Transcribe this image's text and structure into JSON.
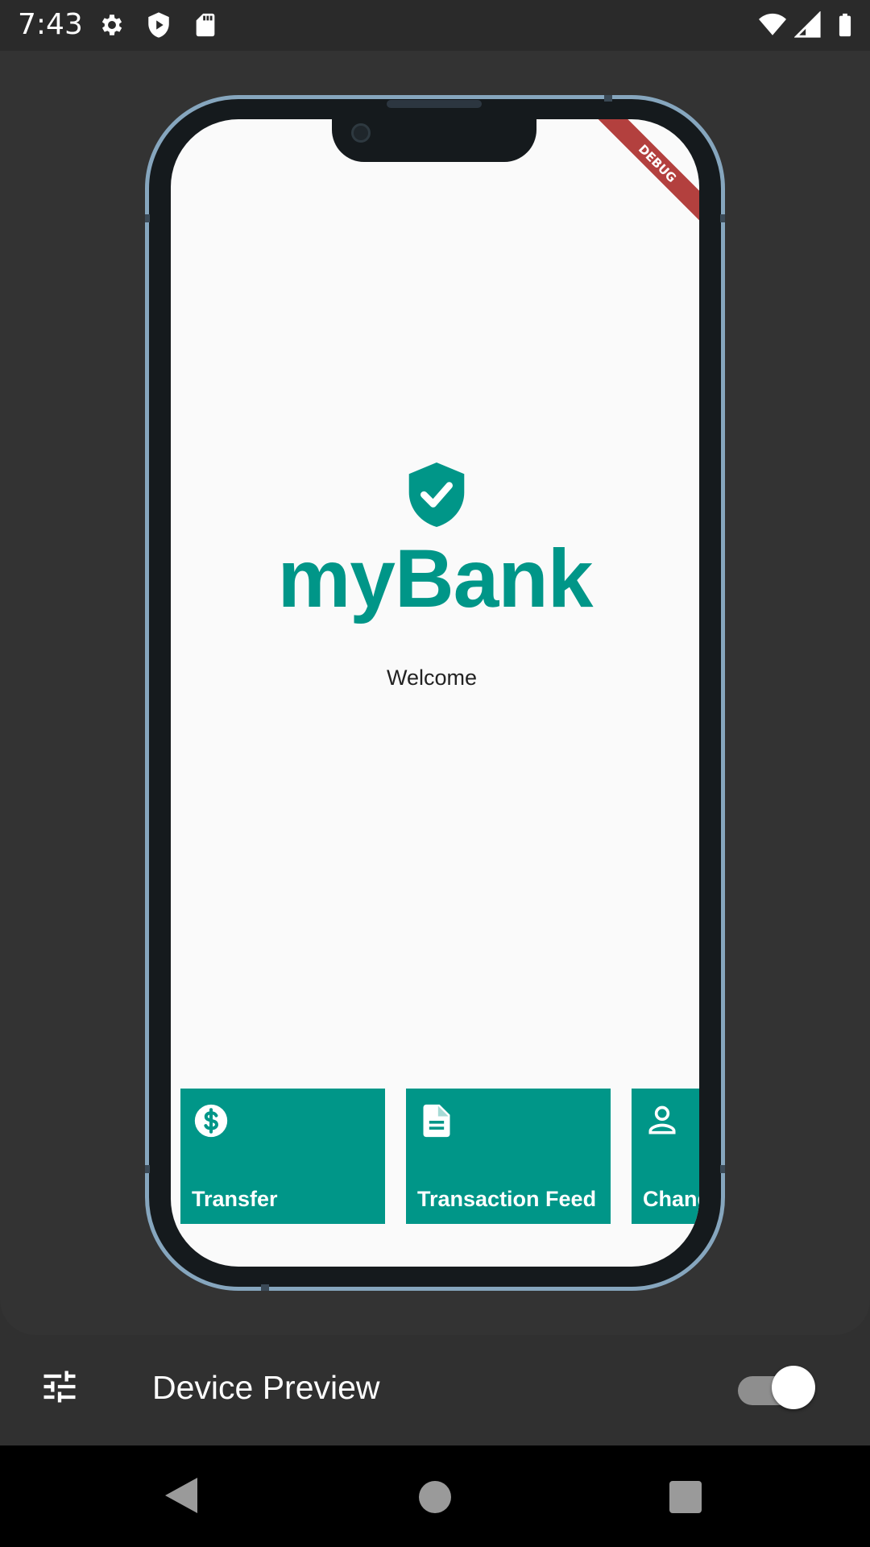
{
  "status_bar": {
    "time": "7:43",
    "icons": [
      "settings-gear-icon",
      "shield-play-icon",
      "sd-card-icon",
      "wifi-icon",
      "signal-icon",
      "battery-icon"
    ]
  },
  "app": {
    "debug_banner": "DEBUG",
    "logo_icon": "shield-check-icon",
    "title": "myBank",
    "welcome": "Welcome",
    "accent_color": "#009688",
    "tiles": [
      {
        "label": "Transfer",
        "icon": "dollar-circle-icon"
      },
      {
        "label": "Transaction Feed",
        "icon": "document-icon"
      },
      {
        "label": "Chang",
        "icon": "person-icon"
      }
    ]
  },
  "toolbar": {
    "title": "Device Preview",
    "settings_icon": "tune-icon",
    "toggle_on": true
  },
  "nav_bar": {
    "icons": [
      "back-icon",
      "home-icon",
      "recents-icon"
    ]
  }
}
